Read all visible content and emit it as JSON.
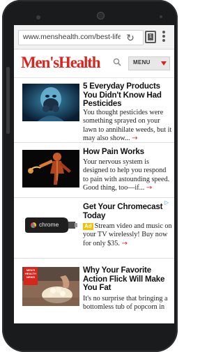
{
  "browser": {
    "url": "www.menshealth.com/best-life/",
    "tab_count": "1"
  },
  "site": {
    "logo": "Men'sHealth",
    "menu_label": "MENU"
  },
  "articles": [
    {
      "title": "5 Everyday Products You Didn't Know Had Pesticides",
      "body": "You thought pesticides were something sprayed on your lawn to annihilate weeds, but it may also show...",
      "arrow": "→",
      "thumb_icon": "gas-mask-person-image"
    },
    {
      "title": "How Pain Works",
      "body": "Your nervous system is designed to help you respond to pain with astounding speed. Good thing, too—if...",
      "arrow": "→",
      "thumb_icon": "anatomy-figure-image"
    },
    {
      "title": "Get Your Chromecast Today",
      "ad_badge": "Ad",
      "body": "Stream video and music on your TV wirelessly! Buy now for only $35.",
      "arrow": "→",
      "thumb_text": "chrome",
      "thumb_icon": "chromecast-device-image"
    },
    {
      "title": "Why Your Favorite Action Flick Will Make You Fat",
      "body": "It's no surprise that bringing a bottomless tub of popcorn in",
      "thumb_badge": "MEN'S HEALTH NEWS",
      "thumb_icon": "popcorn-image"
    }
  ],
  "colors": {
    "brand_red": "#d8261c",
    "ad_yellow": "#f2c200",
    "phone_body": "#1a1b1c"
  }
}
